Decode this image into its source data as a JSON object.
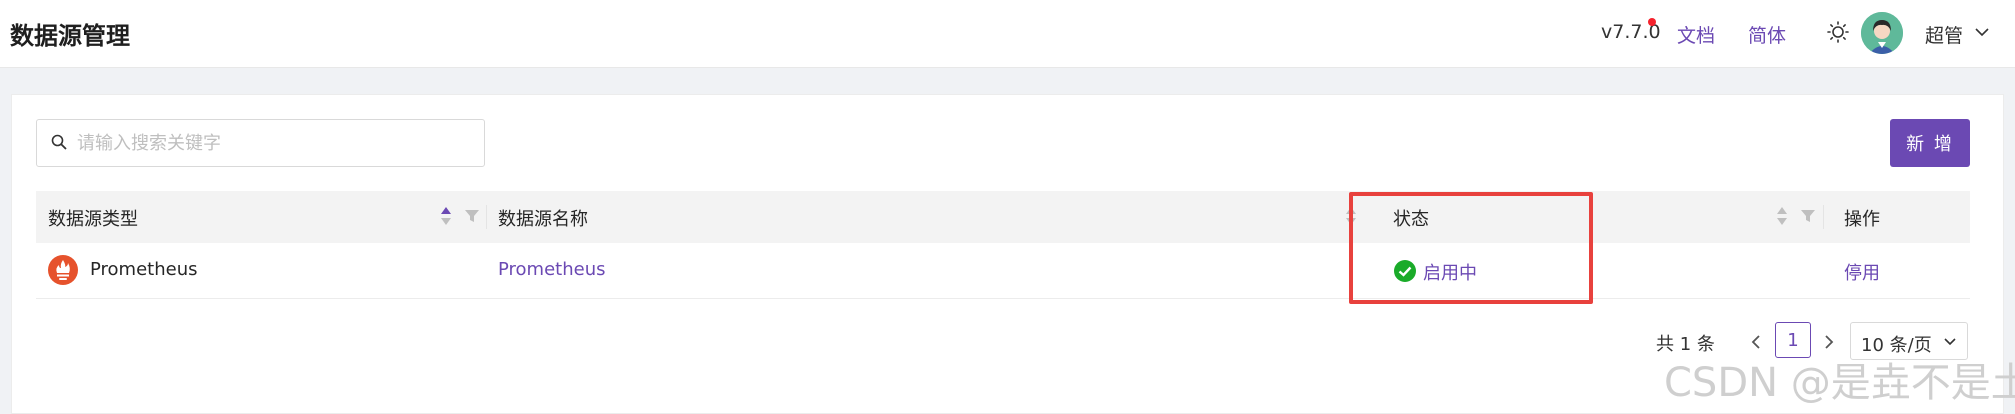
{
  "page": {
    "title": "数据源管理"
  },
  "header": {
    "version": "v7.7.0",
    "docs_link": "文档",
    "lang_link": "简体",
    "user_name": "超管"
  },
  "toolbar": {
    "search_placeholder": "请输入搜索关键字",
    "search_value": "",
    "add_button": "新 增"
  },
  "table": {
    "columns": [
      "数据源类型",
      "数据源名称",
      "状态",
      "操作"
    ],
    "rows": [
      {
        "type": "Prometheus",
        "name": "Prometheus",
        "status": "启用中",
        "action": "停用"
      }
    ]
  },
  "pagination": {
    "total": "共 1 条",
    "current": "1",
    "page_size": "10 条/页"
  },
  "watermark": "CSDN @是垚不是土",
  "colors": {
    "accent": "#6b49b3",
    "status_ok": "#1aab29",
    "highlight": "#e8413d"
  }
}
